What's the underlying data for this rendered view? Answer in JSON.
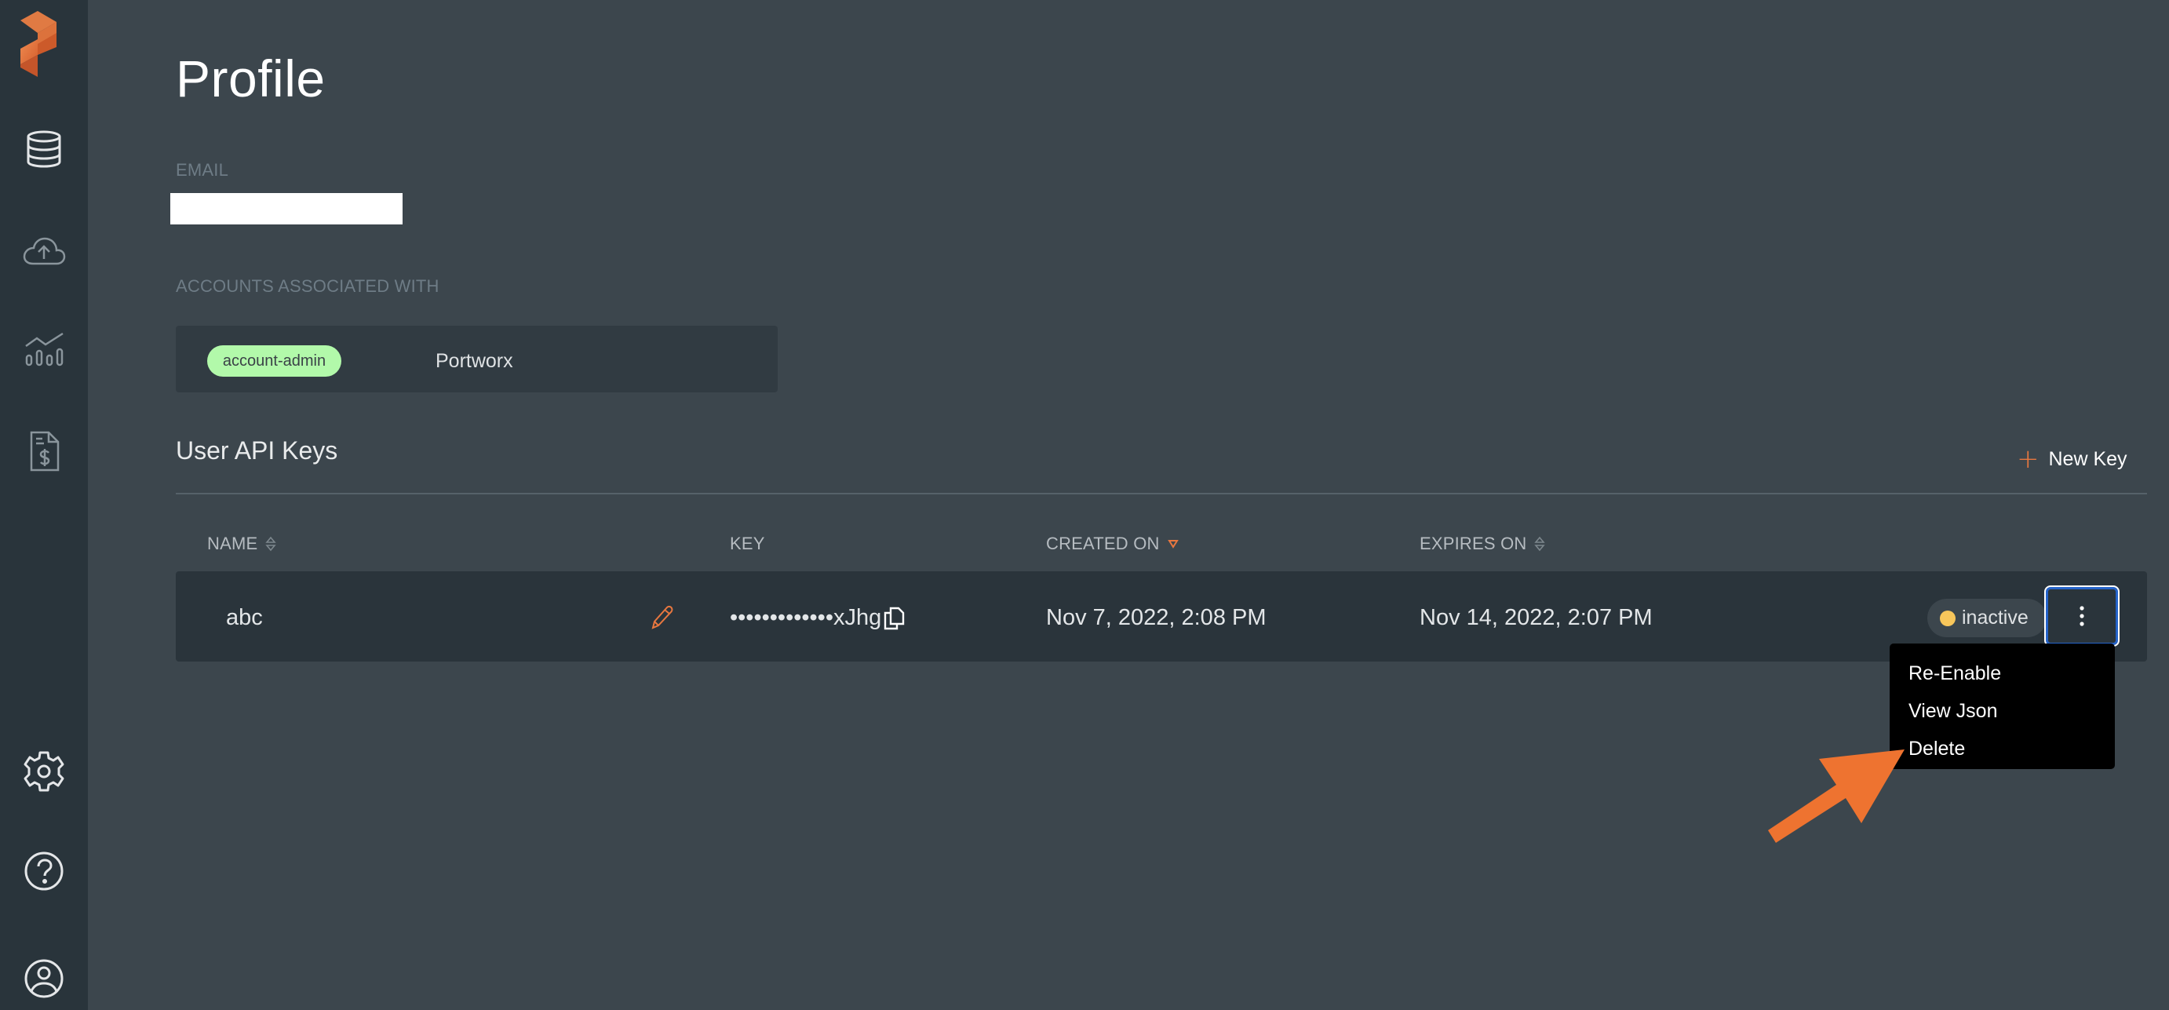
{
  "sidebar": {
    "items": [
      {
        "icon": "database-icon",
        "name": "sidebar-item-data",
        "active": true
      },
      {
        "icon": "cloud-upload-icon",
        "name": "sidebar-item-cloud"
      },
      {
        "icon": "analytics-icon",
        "name": "sidebar-item-analytics"
      },
      {
        "icon": "billing-icon",
        "name": "sidebar-item-billing"
      }
    ],
    "bottom_items": [
      {
        "icon": "gear-icon",
        "name": "sidebar-item-settings"
      },
      {
        "icon": "help-icon",
        "name": "sidebar-item-help"
      },
      {
        "icon": "user-icon",
        "name": "sidebar-item-profile"
      }
    ]
  },
  "page": {
    "title": "Profile",
    "email_label": "EMAIL",
    "email_value": "",
    "accounts_label": "ACCOUNTS ASSOCIATED WITH",
    "accounts": [
      {
        "role": "account-admin",
        "name": "Portworx"
      }
    ]
  },
  "api_keys": {
    "title": "User API Keys",
    "new_key_label": "New Key",
    "columns": [
      {
        "label": "NAME",
        "sort": "none"
      },
      {
        "label": "KEY",
        "sort": null
      },
      {
        "label": "CREATED ON",
        "sort": "desc"
      },
      {
        "label": "EXPIRES ON",
        "sort": "none"
      }
    ],
    "rows": [
      {
        "name": "abc",
        "key": "•••••••••••••xJhg",
        "created_on": "Nov 7, 2022, 2:08 PM",
        "expires_on": "Nov 14, 2022, 2:07 PM",
        "status": "inactive"
      }
    ],
    "row_menu": [
      "Re-Enable",
      "View Json",
      "Delete"
    ]
  },
  "colors": {
    "accent": "#e8773f",
    "sidebar_bg": "#29343b",
    "page_bg": "#3c464d",
    "role_badge": "#b2f9aa",
    "status_inactive": "#f7c65b",
    "focus_ring": "#2563c9"
  }
}
